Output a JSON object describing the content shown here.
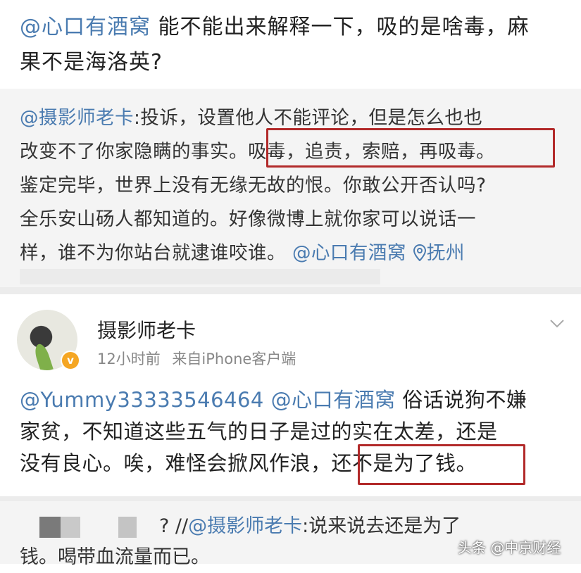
{
  "top_post": {
    "mention": "@心口有酒窝",
    "text_line1": " 能不能出来解释一下，吸的是啥毒，麻",
    "text_line2": "果不是海洛英?"
  },
  "repost": {
    "mention": "@摄影师老卡",
    "line1": ":投诉，设置他人不能评论，但是怎么也也",
    "line2_a": "改变不了你家隐瞒的事实。",
    "line2_highlight": "吸毒，追责，索赔，再吸毒。",
    "line3": "鉴定完毕，世界上没有无缘无故的恨。你敢公开否认吗?",
    "line4": "全乐安山砀人都知道的。好像微博上就你家可以说话一",
    "line5": "样，谁不为你站台就逮谁咬谁。",
    "line5_mention": "@心口有酒窝",
    "location_icon": "location-pin-icon",
    "location": "抚州"
  },
  "comment": {
    "username": "摄影师老卡",
    "time": "12小时前",
    "source": "来自iPhone客户端",
    "mention1": "@Yummy33333546464",
    "mention2": "@心口有酒窝",
    "line1_rest": " 俗话说狗不嫌",
    "line2": "家贫，不知道这些五气的日子是过的实在太差，还是",
    "line3_a": "没有良心。唉，难怪会掀风作浪，",
    "line3_highlight": "还不是为了钱。",
    "verified_badge": "v",
    "accent_color": "#f5a623"
  },
  "reply": {
    "prefix": "?  //",
    "mention": "@摄影师老卡",
    "text1": ":说来说去还是为了",
    "text2": "钱。喝带血流量而已。"
  },
  "watermark": "头条 @中京财经",
  "colors": {
    "link": "#4a7bb0",
    "highlight_border": "#b22a2a",
    "repost_bg": "#f4f4f4"
  }
}
